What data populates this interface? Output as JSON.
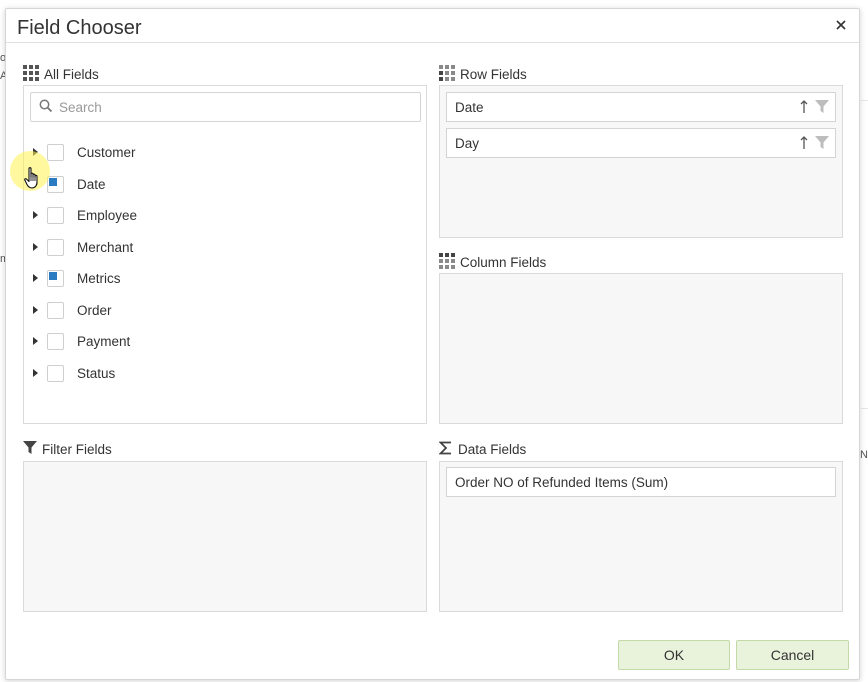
{
  "dialog": {
    "title": "Field Chooser",
    "close_icon": "close-icon"
  },
  "background_fragments": [
    "o,",
    "Al",
    "m",
    "N("
  ],
  "all_fields": {
    "label": "All Fields",
    "icon": "grid-icon",
    "search_placeholder": "Search",
    "search_value": "",
    "items": [
      {
        "label": "Customer",
        "state": "unchecked"
      },
      {
        "label": "Date",
        "state": "partial"
      },
      {
        "label": "Employee",
        "state": "unchecked"
      },
      {
        "label": "Merchant",
        "state": "unchecked"
      },
      {
        "label": "Metrics",
        "state": "partial"
      },
      {
        "label": "Order",
        "state": "unchecked"
      },
      {
        "label": "Payment",
        "state": "unchecked"
      },
      {
        "label": "Status",
        "state": "unchecked"
      }
    ]
  },
  "row_fields": {
    "label": "Row Fields",
    "icon": "row-grid-icon",
    "items": [
      {
        "label": "Date",
        "sort_icon": "sort-ascending-icon",
        "filter_icon": "filter-icon"
      },
      {
        "label": "Day",
        "sort_icon": "sort-ascending-icon",
        "filter_icon": "filter-icon"
      }
    ]
  },
  "column_fields": {
    "label": "Column Fields",
    "icon": "column-grid-icon",
    "items": []
  },
  "filter_fields": {
    "label": "Filter Fields",
    "icon": "filter-icon",
    "items": []
  },
  "data_fields": {
    "label": "Data Fields",
    "icon": "sigma-icon",
    "items": [
      {
        "label": "Order NO of Refunded Items (Sum)"
      }
    ]
  },
  "buttons": {
    "ok": "OK",
    "cancel": "Cancel"
  },
  "colors": {
    "accent": "#2a7bc2",
    "button_bg": "#e9f3dc",
    "panel_bg": "#f7f7f7",
    "cursor_halo": "#fff250"
  }
}
